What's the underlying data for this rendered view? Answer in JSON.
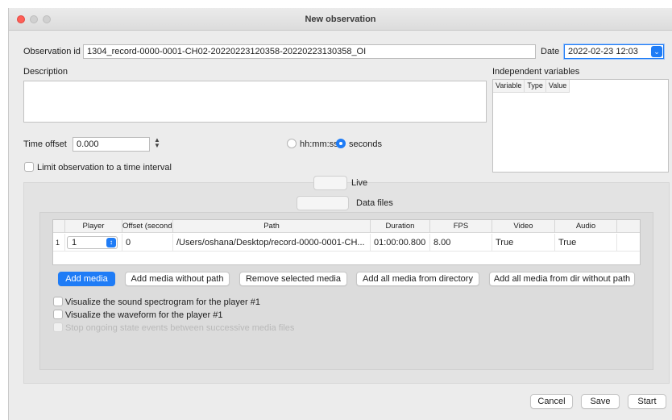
{
  "window": {
    "title": "New observation"
  },
  "observation": {
    "id_label": "Observation id",
    "id_value": "1304_record-0000-0001-CH02-20220223120358-20220223130358_OI",
    "date_label": "Date",
    "date_value": "2022-02-23 12:03"
  },
  "description": {
    "label": "Description",
    "value": ""
  },
  "independent_variables": {
    "label": "Independent variables",
    "columns": [
      "Variable",
      "Type",
      "Value"
    ]
  },
  "time_offset": {
    "label": "Time offset",
    "value": "0.000",
    "format_options": [
      "hh:mm:ss",
      "seconds"
    ],
    "selected_format": "seconds"
  },
  "limit_interval": {
    "label": "Limit observation to a time interval",
    "checked": false
  },
  "tabs": {
    "live": "Live",
    "data_files": "Data files"
  },
  "media_table": {
    "columns": [
      "Player",
      "Offset (seconds)",
      "Path",
      "Duration",
      "FPS",
      "Video",
      "Audio"
    ],
    "rows": [
      {
        "index": "1",
        "player": "1",
        "offset": "0",
        "path": "/Users/oshana/Desktop/record-0000-0001-CH...",
        "duration": "01:00:00.800",
        "fps": "8.00",
        "video": "True",
        "audio": "True"
      }
    ]
  },
  "media_buttons": {
    "add_media": "Add media",
    "add_media_without_path": "Add media without path",
    "remove_selected_media": "Remove selected media",
    "add_all_from_directory": "Add all media from directory",
    "add_all_from_dir_without_path": "Add all media from dir without path"
  },
  "options": {
    "spectrogram": "Visualize the sound spectrogram for the player #1",
    "waveform": "Visualize the waveform for the player #1",
    "stop_state_events": "Stop ongoing state events between successive media files"
  },
  "footer": {
    "cancel": "Cancel",
    "save": "Save",
    "start": "Start"
  },
  "colors": {
    "accent": "#1f7cf6",
    "close": "#fe5f57"
  },
  "icons": {
    "date_dropdown": "chevron-down-icon",
    "stepper": "up-down-stepper-icon",
    "player_dropdown": "up-down-chevron-icon"
  }
}
